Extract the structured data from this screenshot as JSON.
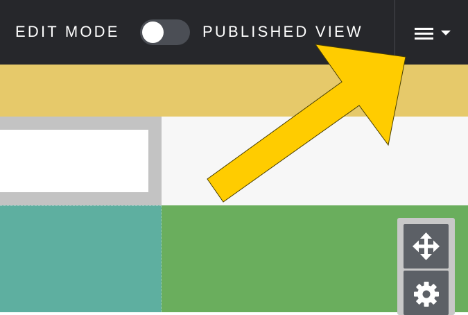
{
  "header": {
    "edit_mode_label": "EDIT MODE",
    "published_view_label": "PUBLISHED VIEW",
    "toggle_state": "off",
    "menu_icon": "hamburger-menu-icon",
    "menu_caret_icon": "caret-down-icon"
  },
  "tools": {
    "move_icon": "move-arrows-icon",
    "settings_icon": "gear-icon"
  },
  "annotation": {
    "type": "arrow",
    "color": "#ffcc00",
    "points_to": "menu-button"
  },
  "colors": {
    "topbar": "#26272b",
    "banner": "#e6c96a",
    "teal": "#5eafa0",
    "green": "#6aae5d",
    "highlight_arrow": "#ffcc00"
  }
}
